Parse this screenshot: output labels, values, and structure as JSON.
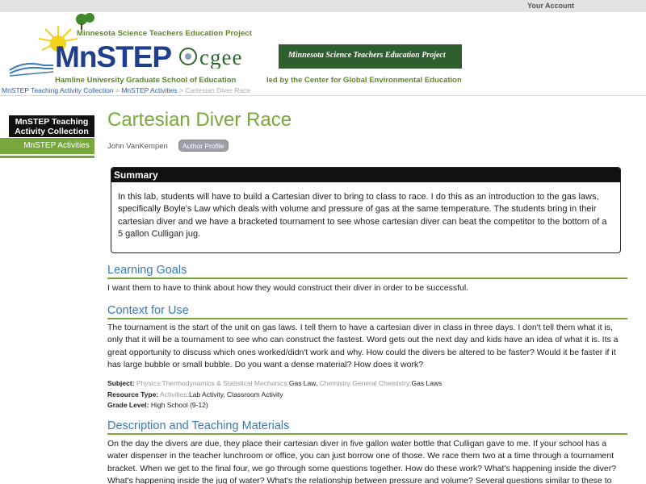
{
  "account": {
    "label": "Your Account"
  },
  "banner": {
    "mn_project": "Minnesota Science Teachers Education Project",
    "logo": "MnSTEP",
    "hamline": "Hamline University Graduate School of Education",
    "cgee_logo": "cgee",
    "cgee_tagline": "Minnesota Science Teachers Education Project",
    "led_by": "led by the Center for Global Environmental Education"
  },
  "breadcrumb": {
    "items": [
      "MnSTEP Teaching Activity Collection",
      "MnSTEP Activities",
      "Cartesian Diver Race"
    ],
    "separator": ">"
  },
  "sidebar": {
    "heading": "MnSTEP Teaching Activity Collection",
    "item": "MnSTEP Activities"
  },
  "page": {
    "title": "Cartesian Diver Race",
    "author": "John VanKempen",
    "author_profile": "Author Profile"
  },
  "summary": {
    "heading": "Summary",
    "text": "In this lab, students will have to build a Cartesian diver to bring to class to race. I do this as an introduction to the gas laws, specifically Boyle's Law which deals with volume and pressure of gas at the same temperature. The students bring in their cartesian diver and we have a bracketed tournament to see whose cartesian diver can beat the competitor to the bottom of a 5 gallon Culligan jug."
  },
  "learning_goals": {
    "heading": "Learning Goals",
    "text": "I want them to have to think about how they would construct their diver in order to be successful."
  },
  "context": {
    "heading": "Context for Use",
    "text": "The tournament is the start of the unit on gas laws. I tell them to have a cartesian diver in class in three days. I don't tell them what it is, only that it will be a tournament to see who can construct the fastest. Word gets out the next day and kids have an idea of what it is. Its a great opportunity to discuss which ones worked/didn't work and why. How could the divers be altered to be faster? Would it be faster if it has large bubble or small bubble. Do you want a dense material? How does it work?"
  },
  "meta": {
    "subject_label": "Subject:",
    "subject_1_path": "Physics:Thermodynamics & Statistical Mechanics:",
    "subject_1_value": "Gas Law",
    "subject_2_path": "Chemistry:General Chemistry:",
    "subject_2_value": "Gas Laws",
    "resource_label": "Resource Type:",
    "resource_path": "Activities:",
    "resource_value": "Lab Activity, Classroom Activity",
    "grade_label": "Grade Level:",
    "grade_value": "High School (9-12)"
  },
  "description": {
    "heading": "Description and Teaching Materials",
    "text": "On the day the divers are due, they place their cartesian diver in five gallon water bottle that Culligan gave to me. If your school has a water dispenser in the teacher lunchroom or office, you can just borrow one of those. We race them two at a time through a tournament bracket. When we get to the final four, we go through some questions together. How do these work? What's happening inside the diver? What's happening inside the jug of water? What's the relationship between pressure and volume? Several questions similar to these to"
  },
  "colors": {
    "green": "#78a83c",
    "blue": "#3a7ab8",
    "navy": "#1f3f8c"
  }
}
